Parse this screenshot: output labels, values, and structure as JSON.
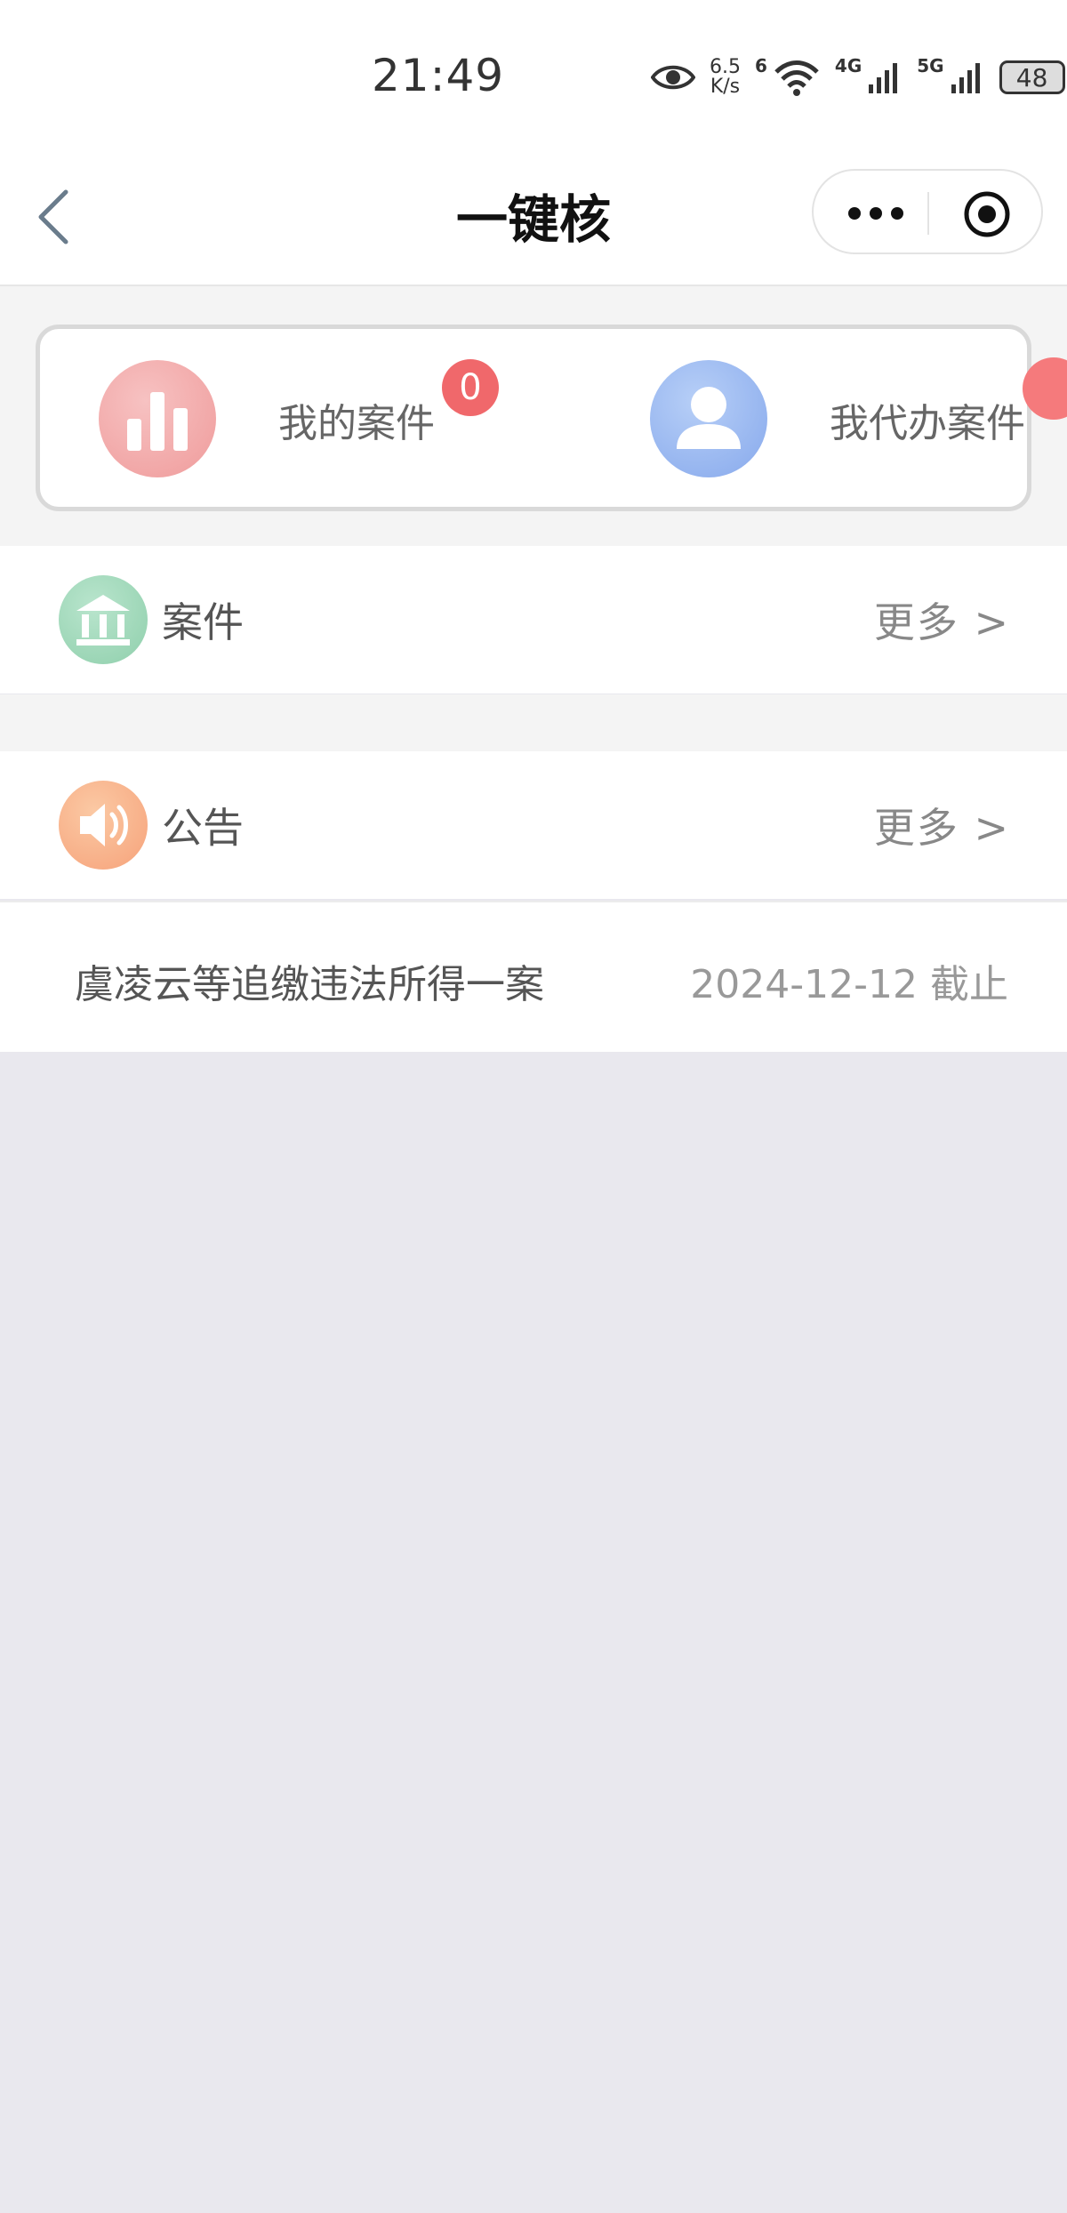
{
  "status_bar": {
    "time": "21:49",
    "net_speed_value": "6.5",
    "net_speed_unit": "K/s",
    "wifi_badge": "6",
    "sim1_label": "4G",
    "sim2_label": "5G",
    "battery": "48"
  },
  "nav": {
    "title": "一键核"
  },
  "quick_actions": [
    {
      "label": "我的案件",
      "badge": "0",
      "color": "#ef9b9b"
    },
    {
      "label": "我代办案件",
      "badge": "",
      "color": "#87a9ec"
    }
  ],
  "sections": {
    "cases": {
      "title": "案件",
      "more": "更多 >"
    },
    "notices": {
      "title": "公告",
      "more": "更多 >"
    }
  },
  "notice_list": [
    {
      "title": "虞凌云等追缴违法所得一案",
      "date": "2024-12-12 截止"
    }
  ],
  "colors": {
    "badge_red": "#f0686b",
    "page_bg": "#e9e8ee",
    "band_bg": "#f4f4f4"
  }
}
